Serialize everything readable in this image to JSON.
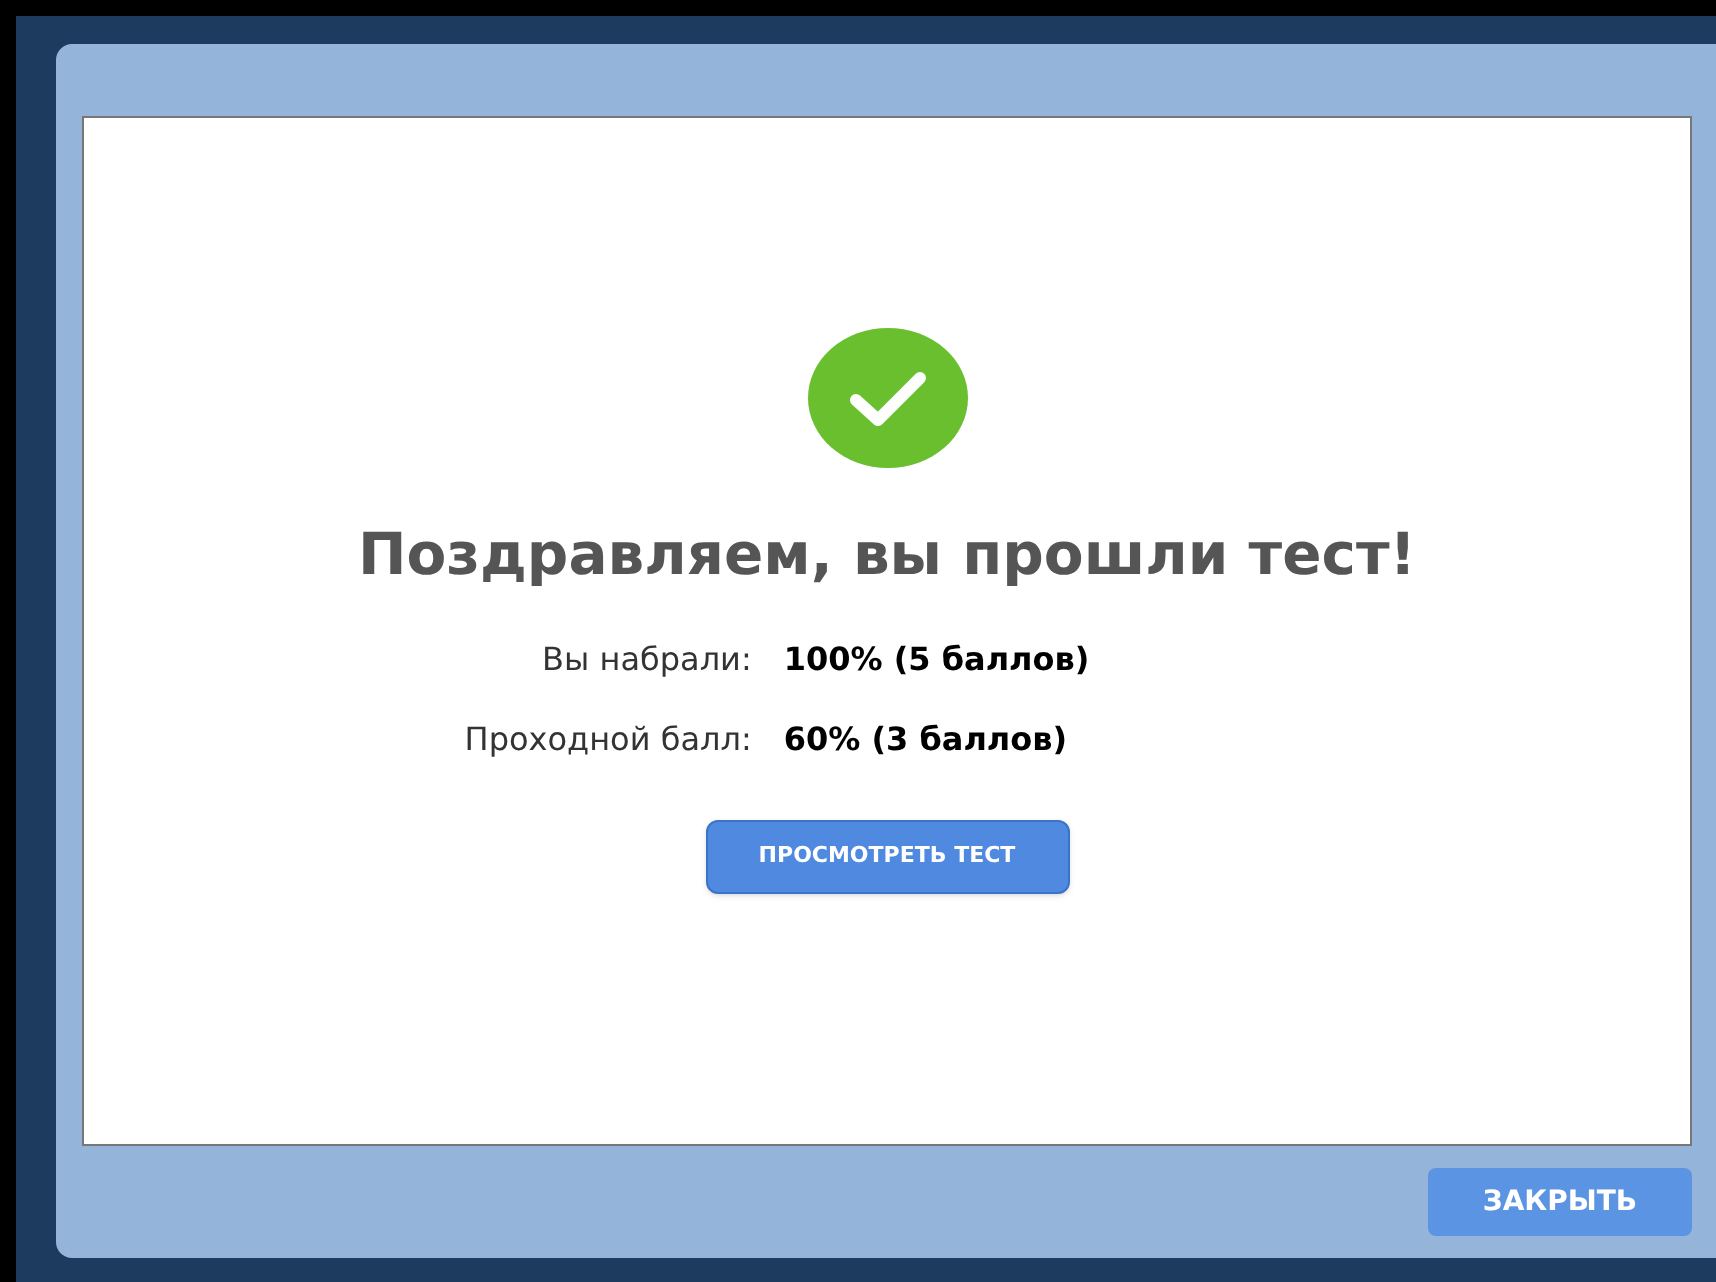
{
  "result": {
    "title": "Поздравляем, вы прошли тест!",
    "rows": [
      {
        "label": "Вы набрали:",
        "value": "100% (5 баллов)"
      },
      {
        "label": "Проходной балл:",
        "value": "60% (3 баллов)"
      }
    ],
    "review_button": "ПРОСМОТРЕТЬ ТЕСТ"
  },
  "footer": {
    "close_button": "ЗАКРЫТЬ"
  }
}
